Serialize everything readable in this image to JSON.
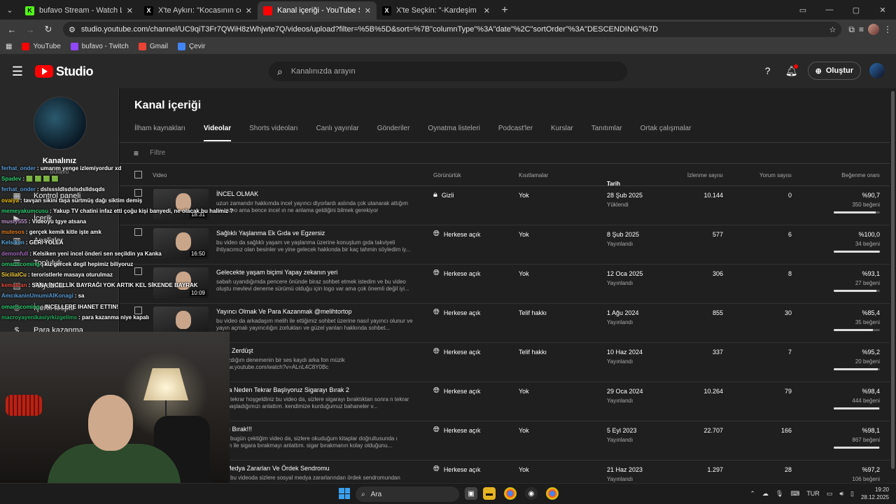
{
  "browser": {
    "tabs": [
      {
        "title": "bufavo Stream - Watch Live on",
        "fav_letter": "K",
        "fav_color": "#53fc18",
        "active": false
      },
      {
        "title": "X'te Aykırı: \"Kocasının cezaevinde",
        "fav_letter": "X",
        "fav_color": "#000000",
        "active": false
      },
      {
        "title": "Kanal içeriği - YouTube Studio",
        "fav_letter": "",
        "fav_color": "#ff0000",
        "active": true
      },
      {
        "title": "X'te Seçkin: \"-Kardeşim bi 200 l",
        "fav_letter": "X",
        "fav_color": "#000000",
        "active": false
      }
    ],
    "url": "studio.youtube.com/channel/UC9qiT3Fr7QWiH8zWhjwte7Q/videos/upload?filter=%5B%5D&sort=%7B\"columnType\"%3A\"date\"%2C\"sortOrder\"%3A\"DESCENDING\"%7D",
    "bookmarks": [
      {
        "label": "YouTube",
        "color": "#ff0000"
      },
      {
        "label": "bufavo - Twitch",
        "color": "#9146ff"
      },
      {
        "label": "Gmail",
        "color": "#ea4335"
      },
      {
        "label": "Çevir",
        "color": "#4285f4"
      }
    ]
  },
  "studio": {
    "logo_text": "Studio",
    "search_placeholder": "Kanalınızda arayın",
    "create_label": "Oluştur"
  },
  "sidebar": {
    "channel_label": "Kanalınız",
    "channel_name": "bufavo",
    "items": [
      {
        "label": "Kontrol paneli",
        "icon": "dashboard-icon"
      },
      {
        "label": "İçerik",
        "icon": "content-icon"
      },
      {
        "label": "Analizler",
        "icon": "analytics-icon"
      },
      {
        "label": "Topluluk",
        "icon": "community-icon"
      },
      {
        "label": "Altyazılar",
        "icon": "subtitles-icon"
      },
      {
        "label": "İçerik tespiti",
        "icon": "copyright-icon"
      },
      {
        "label": "Para kazanma",
        "icon": "monetization-icon"
      }
    ]
  },
  "main": {
    "title": "Kanal içeriği",
    "tabs": [
      "İlham kaynakları",
      "Videolar",
      "Shorts videoları",
      "Canlı yayınlar",
      "Gönderiler",
      "Oynatma listeleri",
      "Podcast'ler",
      "Kurslar",
      "Tanıtımlar",
      "Ortak çalışmalar"
    ],
    "active_tab": 1,
    "filter_placeholder": "Filtre",
    "columns": {
      "video": "Video",
      "visibility": "Görünürlük",
      "restrictions": "Kısıtlamalar",
      "date": "Tarih",
      "views": "İzlenme sayısı",
      "comments": "Yorum sayısı",
      "likes": "Beğenme oranı"
    },
    "rows": [
      {
        "title": "İNCEL OLMAK",
        "desc": "uzun zamandır hakkımda incel yayıncı diyorlardı aslında çok utanarak attığım bir video ama bence incel ın ne anlama geldiğini bilmek gerekiyor",
        "duration": "18:31",
        "visibility": "Gizli",
        "vis_icon": "lock-icon",
        "restriction": "Yok",
        "date": "28 Şub 2025",
        "date_sub": "Yüklendi",
        "views": "10.144",
        "comments": "0",
        "like_pct": "%90,7",
        "likes": "350 beğeni",
        "like_ratio": 0.907
      },
      {
        "title": "Sağlıklı Yaşlanma Ek Gıda ve Egzersiz",
        "desc": "bu video da sağlıklı yaşam ve yaşlanma üzerine konuştum gıda takviyeli ihtiyacımız olan besinler ve yine gelecek hakkında bir kaç tahmin söyledim iy...",
        "duration": "16:50",
        "visibility": "Herkese açık",
        "vis_icon": "globe-icon",
        "restriction": "Yok",
        "date": "8 Şub 2025",
        "date_sub": "Yayınlandı",
        "views": "577",
        "comments": "6",
        "like_pct": "%100,0",
        "likes": "34 beğeni",
        "like_ratio": 1.0
      },
      {
        "title": "Gelecekte yaşam biçimi Yapay zekanın yeri",
        "desc": "sabah uyandığımda pencere önünde biraz sohbet etmek istedim ve bu video oluştu mevlevi deneme sürümü olduğu için logo var ama çok önemli değil iyi...",
        "duration": "10:09",
        "visibility": "Herkese açık",
        "vis_icon": "globe-icon",
        "restriction": "Yok",
        "date": "12 Oca 2025",
        "date_sub": "Yayınlandı",
        "views": "306",
        "comments": "8",
        "like_pct": "%93,1",
        "likes": "27 beğeni",
        "like_ratio": 0.931
      },
      {
        "title": "Yayıncı Olmak Ve Para Kazanmak @melihtortop",
        "desc": "bu video da arkadaşım melih ile ettiğimiz sohbet üzerine nasıl yayıncı olunur ve yayın açmalı yayıncılığın zorlukları ve güzel yanları hakkında sohbet...",
        "duration": "",
        "visibility": "Herkese açık",
        "vis_icon": "globe-icon",
        "restriction": "Telif hakkı",
        "date": "1 Ağu 2024",
        "date_sub": "Yayınlandı",
        "views": "855",
        "comments": "30",
        "like_pct": "%85,4",
        "likes": "35 beğeni",
        "like_ratio": 0.854
      },
      {
        "title": "d VE Zerdüşt",
        "desc": "yi yazdığım denemenin bir ses kaydı arka fon müzik ://www.youtube.com/watch?v=ALnL4C8Y0Bc",
        "duration": "",
        "visibility": "Herkese açık",
        "vis_icon": "globe-icon",
        "restriction": "Telif hakkı",
        "date": "10 Haz 2024",
        "date_sub": "Yayınlandı",
        "views": "337",
        "comments": "7",
        "like_pct": "%95,2",
        "likes": "20 beğeni",
        "like_ratio": 0.952
      },
      {
        "title": "araya Neden Tekrar Başlıyoruz Sigarayı Bırak 2",
        "desc": "baba tekrar hoşgeldiniz bu video da, sizlere sigarayı bıraktıktan sonra n tekrar geri başladığımızı anlattım. kendimize kurduğumuz bahaneler v...",
        "duration": "",
        "visibility": "Herkese açık",
        "vis_icon": "globe-icon",
        "restriction": "Yok",
        "date": "29 Oca 2024",
        "date_sub": "Yayınlandı",
        "views": "10.264",
        "comments": "79",
        "like_pct": "%98,4",
        "likes": "444 beğeni",
        "like_ratio": 0.984
      },
      {
        "title": "arayı Bırak!!!",
        "desc": "baba bugün çektiğim video da, sizlere okuduğum kitaplar doğrultusunda ı tarzım ile sigara bırakmayı anlattım. sigar bırakmanın kolay olduğunu...",
        "duration": "",
        "visibility": "Herkese açık",
        "vis_icon": "globe-icon",
        "restriction": "Yok",
        "date": "5 Eyl 2023",
        "date_sub": "Yayınlandı",
        "views": "22.707",
        "comments": "166",
        "like_pct": "%98,1",
        "likes": "867 beğeni",
        "like_ratio": 0.981
      },
      {
        "title": "yal Medya Zararları Ve Ördek Sendromu",
        "desc": "baba bu videoda sizlere sosyal medya zararlarından ördek sendromundan",
        "duration": "",
        "visibility": "Herkese açık",
        "vis_icon": "globe-icon",
        "restriction": "Yok",
        "date": "21 Haz 2023",
        "date_sub": "Yayınlandı",
        "views": "1.297",
        "comments": "28",
        "like_pct": "%97,2",
        "likes": "106 beğeni",
        "like_ratio": 0.972
      }
    ]
  },
  "chat": [
    {
      "user": "ferhat_onder",
      "text": ": umarım yenge izlemiyordur xd",
      "color": "#5b9bd5"
    },
    {
      "user": "Spadev",
      "text": ": 🟩 🟩 🟩 🟩",
      "color": "#2ecc71"
    },
    {
      "user": "ferhat_onder",
      "text": ": dslsssldlsdslsdslldsqds",
      "color": "#5b9bd5"
    },
    {
      "user": "ovaiya",
      "text": ": tavşan sikini taşa sürtmüş dağı siktim demiş",
      "color": "#f1c40f"
    },
    {
      "user": "memeyakumcusu",
      "text": ": Yakup TV chatini infaz etti çoğu kişi banyedi, ne olacak bu halimiz ?",
      "color": "#2ecc71"
    },
    {
      "user": "musty555",
      "text": ": Videoyu tgye atsana",
      "color": "#c39bd3"
    },
    {
      "user": "mutesos",
      "text": ": gerçek kemik kitle işte amk",
      "color": "#e67e22"
    },
    {
      "user": "Kelsiken",
      "text": ": GERİ YOLLA",
      "color": "#5dade2"
    },
    {
      "user": "demonfull",
      "text": ": Kelsiken yeni incel önderi sen seçildin ya Kanka",
      "color": "#a569bd"
    },
    {
      "user": "omariscoming",
      "text": ": kiz gercek degil hepimiz biliyoruz",
      "color": "#2ecc71"
    },
    {
      "user": "SicilialCu",
      "text": ": teroristlerle masaya oturulmaz",
      "color": "#f4d03f"
    },
    {
      "user": "kemalcan",
      "text": ": SANA İNCELLİK BAYRAĞI YOK ARTIK KEL SİKENDE BAYRAK",
      "color": "#e74c3c"
    },
    {
      "user": "AmcıkaninUmumiAlKonagi",
      "text": ": sa",
      "color": "#5b9bd5"
    },
    {
      "user": "omariscoming",
      "text": ": INCELLERE IHANET ETTIN!",
      "color": "#2ecc71"
    },
    {
      "user": "macroyayenikasiyrkizgelims",
      "text": ": para kazanma niye kapalı",
      "color": "#27ae60"
    }
  ],
  "taskbar": {
    "search_label": "Ara",
    "lang": "TUR",
    "time": "19:20",
    "date": "28.12.2025"
  }
}
